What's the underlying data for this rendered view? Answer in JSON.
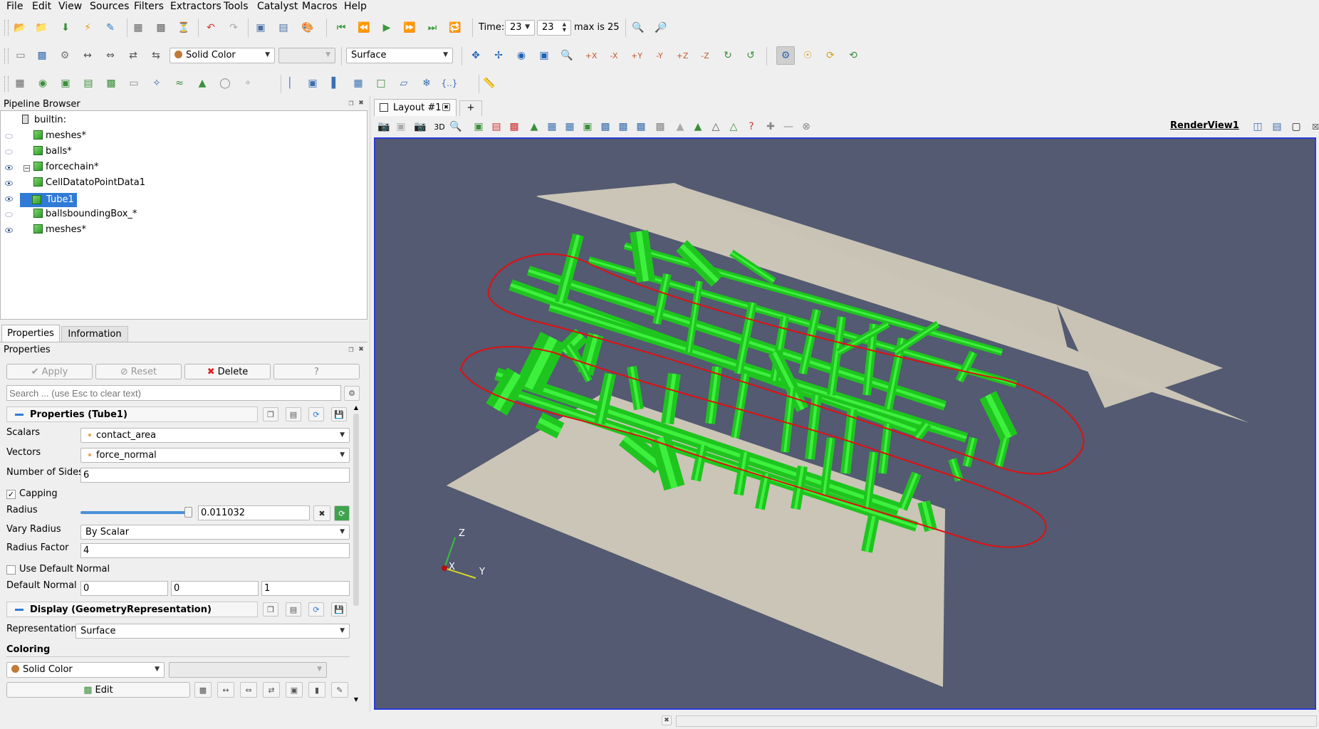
{
  "menu": {
    "file": "File",
    "edit": "Edit",
    "view": "View",
    "sources": "Sources",
    "filters": "Filters",
    "extractors": "Extractors",
    "tools": "Tools",
    "catalyst": "Catalyst",
    "macros": "Macros",
    "help": "Help"
  },
  "time_bar": {
    "label": "Time:",
    "time_value": "23",
    "step_value": "23",
    "max_text": "max is 25"
  },
  "display_bar": {
    "color_by": "Solid Color",
    "component": "",
    "representation": "Surface"
  },
  "pipeline": {
    "title": "Pipeline Browser",
    "root": "builtin:",
    "items": [
      {
        "label": "meshes*"
      },
      {
        "label": "balls*"
      },
      {
        "label": "forcechain*"
      },
      {
        "label": "CellDatatoPointData1"
      },
      {
        "label": "Tube1"
      },
      {
        "label": "ballsboundingBox_*"
      },
      {
        "label": "meshes*"
      }
    ]
  },
  "tabs": {
    "properties": "Properties",
    "information": "Information"
  },
  "properties_panel": {
    "title": "Properties",
    "apply": "Apply",
    "reset": "Reset",
    "delete": "Delete",
    "help": "?",
    "search_placeholder": "Search ... (use Esc to clear text)",
    "section1": "Properties (Tube1)",
    "scalars_label": "Scalars",
    "scalars_value": "contact_area",
    "vectors_label": "Vectors",
    "vectors_value": "force_normal",
    "sides_label": "Number of Sides",
    "sides_value": "6",
    "capping_label": "Capping",
    "capping_checked": true,
    "radius_label": "Radius",
    "radius_value": "0.011032",
    "radius_slider_fraction": 0.98,
    "vary_label": "Vary Radius",
    "vary_value": "By Scalar",
    "factor_label": "Radius Factor",
    "factor_value": "4",
    "use_default_label": "Use Default Normal",
    "use_default_checked": false,
    "default_normal_label": "Default Normal",
    "normal": [
      "0",
      "0",
      "1"
    ],
    "section2": "Display (GeometryRepresentation)",
    "representation_label": "Representation",
    "representation_value": "Surface",
    "coloring_label": "Coloring",
    "coloring_value": "Solid Color",
    "coloring_component": "",
    "edit_label": "Edit"
  },
  "layout": {
    "tab_label": "Layout #1",
    "add_tab": "+",
    "view_name": "RenderView1",
    "mode_3d": "3D"
  },
  "axes": {
    "x": "X",
    "y": "Y",
    "z": "Z"
  },
  "colors": {
    "view_bg": "#535a71",
    "tube": "#1fc51f",
    "plane": "#c9c3b5",
    "highlight": "#2f7bd6",
    "annotation": "#e01010"
  }
}
